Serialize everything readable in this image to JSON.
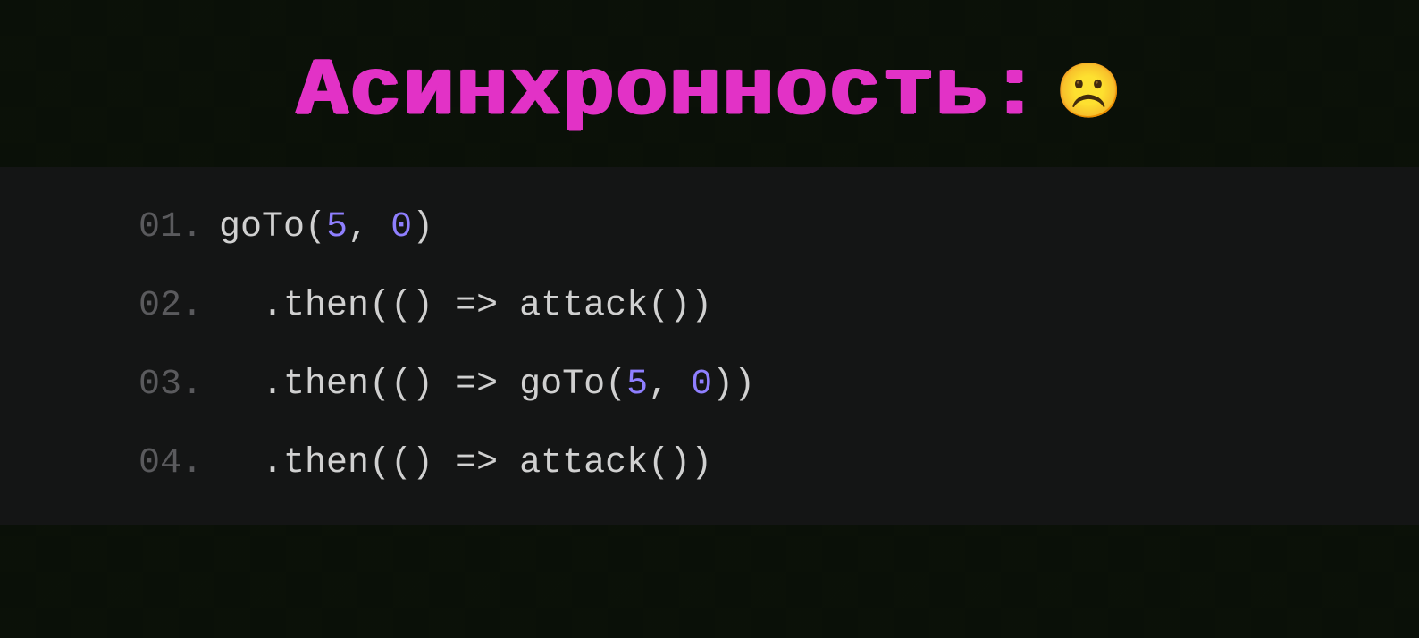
{
  "title": {
    "text": "Асинхронность:",
    "emoji": "☹️"
  },
  "code": {
    "lines": [
      {
        "number": "01.",
        "indent": "",
        "tokens": [
          {
            "cls": "tok-plain",
            "text": "goTo"
          },
          {
            "cls": "tok-punct",
            "text": "("
          },
          {
            "cls": "tok-number",
            "text": "5"
          },
          {
            "cls": "tok-punct",
            "text": ", "
          },
          {
            "cls": "tok-number",
            "text": "0"
          },
          {
            "cls": "tok-punct",
            "text": ")"
          }
        ]
      },
      {
        "number": "02.",
        "indent": "  ",
        "tokens": [
          {
            "cls": "tok-punct",
            "text": "."
          },
          {
            "cls": "tok-method",
            "text": "then"
          },
          {
            "cls": "tok-punct",
            "text": "(() "
          },
          {
            "cls": "tok-arrow",
            "text": "=>"
          },
          {
            "cls": "tok-punct",
            "text": " "
          },
          {
            "cls": "tok-plain",
            "text": "attack"
          },
          {
            "cls": "tok-punct",
            "text": "())"
          }
        ]
      },
      {
        "number": "03.",
        "indent": "  ",
        "tokens": [
          {
            "cls": "tok-punct",
            "text": "."
          },
          {
            "cls": "tok-method",
            "text": "then"
          },
          {
            "cls": "tok-punct",
            "text": "(() "
          },
          {
            "cls": "tok-arrow",
            "text": "=>"
          },
          {
            "cls": "tok-punct",
            "text": " "
          },
          {
            "cls": "tok-plain",
            "text": "goTo"
          },
          {
            "cls": "tok-punct",
            "text": "("
          },
          {
            "cls": "tok-number",
            "text": "5"
          },
          {
            "cls": "tok-punct",
            "text": ", "
          },
          {
            "cls": "tok-number",
            "text": "0"
          },
          {
            "cls": "tok-punct",
            "text": "))"
          }
        ]
      },
      {
        "number": "04.",
        "indent": "  ",
        "tokens": [
          {
            "cls": "tok-punct",
            "text": "."
          },
          {
            "cls": "tok-method",
            "text": "then"
          },
          {
            "cls": "tok-punct",
            "text": "(() "
          },
          {
            "cls": "tok-arrow",
            "text": "=>"
          },
          {
            "cls": "tok-punct",
            "text": " "
          },
          {
            "cls": "tok-plain",
            "text": "attack"
          },
          {
            "cls": "tok-punct",
            "text": "())"
          }
        ]
      }
    ]
  }
}
